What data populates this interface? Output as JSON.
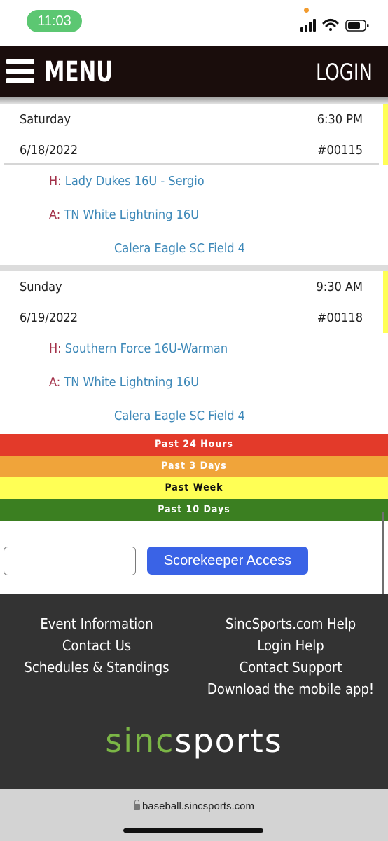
{
  "status_bar": {
    "time": "11:03"
  },
  "header": {
    "menu_label": "MENU",
    "login_label": "LOGIN"
  },
  "games": [
    {
      "day": "Saturday",
      "time": "6:30 PM",
      "date": "6/18/2022",
      "game_number": "#00115",
      "home_prefix": "H:",
      "home_team": "Lady Dukes 16U - Sergio",
      "away_prefix": "A:",
      "away_team": "TN White Lightning 16U",
      "field": "Calera Eagle SC Field 4"
    },
    {
      "day": "Sunday",
      "time": "9:30 AM",
      "date": "6/19/2022",
      "game_number": "#00118",
      "home_prefix": "H:",
      "home_team": "Southern Force 16U-Warman",
      "away_prefix": "A:",
      "away_team": "TN White Lightning 16U",
      "field": "Calera Eagle SC Field 4"
    }
  ],
  "legend": [
    {
      "label": "Past 24 Hours",
      "color": "#e33a2a",
      "text_color": "#ffffff"
    },
    {
      "label": "Past 3 Days",
      "color": "#f0a43a",
      "text_color": "#ffffff"
    },
    {
      "label": "Past Week",
      "color": "#ffff55",
      "text_color": "#111111"
    },
    {
      "label": "Past 10 Days",
      "color": "#3b7f21",
      "text_color": "#ffffff"
    }
  ],
  "scorekeeper": {
    "input_value": "",
    "button_label": "Scorekeeper Access"
  },
  "footer": {
    "left_links": [
      "Event Information",
      "Contact Us",
      "Schedules & Standings"
    ],
    "right_links": [
      "SincSports.com Help",
      "Login Help",
      "Contact Support",
      "Download the mobile app!"
    ],
    "logo_sinc": "sinc",
    "logo_sports": "sports"
  },
  "browser": {
    "url": "baseball.sincsports.com"
  },
  "icons": [
    "signal-icon",
    "wifi-icon",
    "battery-icon",
    "hamburger-menu-icon",
    "lock-icon"
  ]
}
